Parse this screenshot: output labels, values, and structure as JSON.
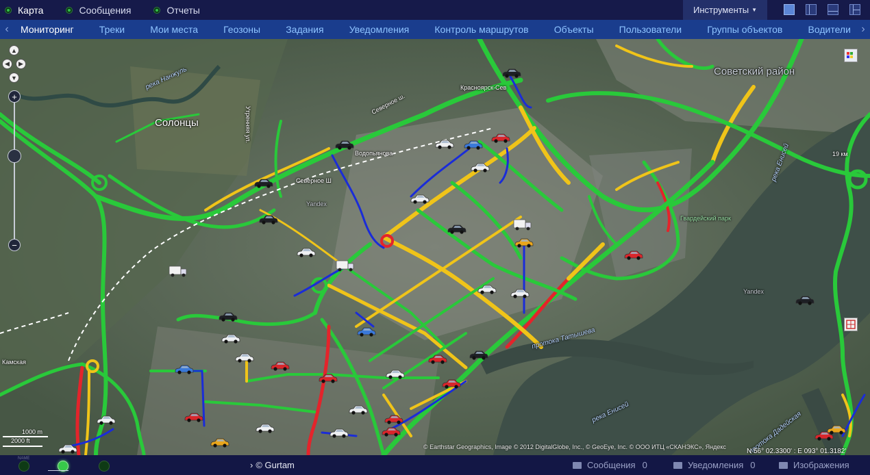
{
  "topnav": {
    "items": [
      {
        "label": "Карта",
        "active": true
      },
      {
        "label": "Сообщения",
        "active": false
      },
      {
        "label": "Отчеты",
        "active": false
      }
    ],
    "tools_label": "Инструменты"
  },
  "subnav": {
    "tabs": [
      {
        "label": "Мониторинг",
        "active": true
      },
      {
        "label": "Треки"
      },
      {
        "label": "Мои места"
      },
      {
        "label": "Геозоны"
      },
      {
        "label": "Задания"
      },
      {
        "label": "Уведомления"
      },
      {
        "label": "Контроль маршрутов"
      },
      {
        "label": "Объекты"
      },
      {
        "label": "Пользователи"
      },
      {
        "label": "Группы объектов"
      },
      {
        "label": "Водители"
      }
    ],
    "prev_glyph": "‹",
    "next_glyph": "›"
  },
  "map": {
    "labels": {
      "solontsy": "Солонцы",
      "sovetsky": "Советский район",
      "nanzhul": "река Нанжуль",
      "severnoe_sh": "Северное ш.",
      "severnoe_sh2": "Северное Ш",
      "vodopyanova": "Водопьянова",
      "krasnoyarsk_sev": "Красноярск-Сев",
      "utrennyaya": "Утренняя ул.",
      "gvardeysky": "Гвардейский парк",
      "enisey": "река Енисей",
      "enisey2": "река Енисей",
      "tatysheva": "протока Татышева",
      "kamskaya": "Камская",
      "dadeyskaya": "протока Дадейская",
      "km19": "19 км",
      "yandex1": "Yandex",
      "yandex2": "Yandex"
    },
    "scale": {
      "top": "1000 m",
      "bottom": "2000 ft"
    },
    "attribution": "© Earthstar Geographics, Image © 2012 DigitalGlobe, Inc., © GeoEye, Inc. © ООО ИТЦ «СКАНЭКС», Яндекс",
    "coordinates": "N 56° 02.3300' : E 093° 01.3182'"
  },
  "footer": {
    "connection_name": "NAME",
    "brand": "© Gurtam",
    "brand_glyph": "›",
    "messages_label": "Сообщения",
    "messages_count": "0",
    "notifications_label": "Уведомления",
    "notifications_count": "0",
    "images_label": "Изображения"
  },
  "colors": {
    "topbar": "#161a4a",
    "subnav": "#1a3d8d",
    "road_green": "#29c93a",
    "road_yellow": "#f0c419",
    "road_red": "#e3242b",
    "track_blue": "#1a2cd8"
  }
}
